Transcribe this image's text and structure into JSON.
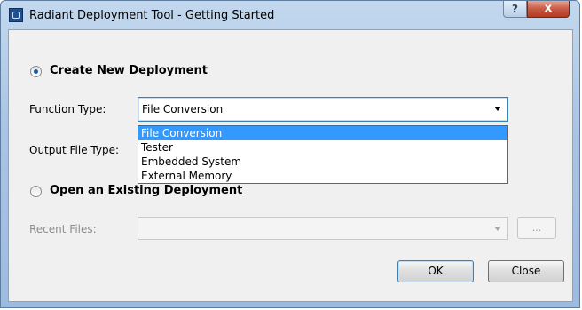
{
  "window": {
    "title": "Radiant Deployment Tool - Getting Started",
    "help_label": "?",
    "close_label": "x"
  },
  "create_section": {
    "radio_label": "Create New Deployment",
    "selected": true,
    "function_type": {
      "label": "Function Type:",
      "value": "File Conversion",
      "expanded": true,
      "options": [
        "File Conversion",
        "Tester",
        "Embedded System",
        "External Memory"
      ],
      "selected_index": 0
    },
    "output_file_type": {
      "label": "Output File Type:"
    }
  },
  "open_section": {
    "radio_label": "Open an Existing Deployment",
    "selected": false,
    "recent_files": {
      "label": "Recent Files:",
      "value": "",
      "disabled": true
    },
    "browse_label": "..."
  },
  "buttons": {
    "ok": "OK",
    "close": "Close"
  },
  "colors": {
    "selection": "#3399ff",
    "radio_dot": "#1c5aa6",
    "focus_border": "#3c7fb1"
  }
}
